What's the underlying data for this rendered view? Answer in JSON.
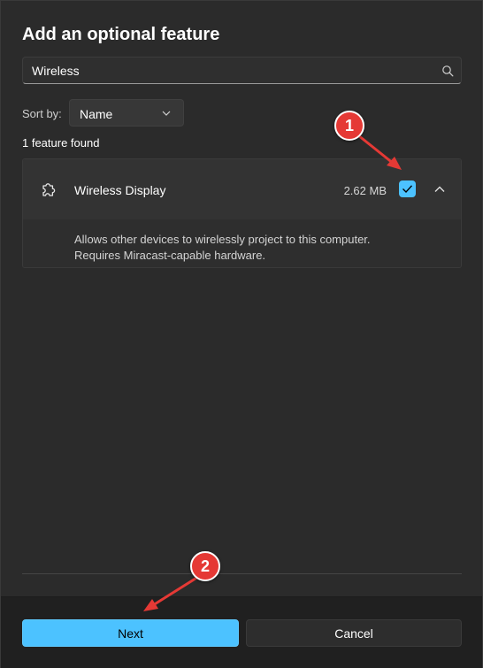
{
  "dialog": {
    "title": "Add an optional feature"
  },
  "search": {
    "value": "Wireless",
    "icon": "search-icon"
  },
  "sort": {
    "label": "Sort by:",
    "selected": "Name"
  },
  "results": {
    "count_text": "1 feature found"
  },
  "features": [
    {
      "name": "Wireless Display",
      "size": "2.62 MB",
      "checked": true,
      "expanded": true,
      "description_line1": "Allows other devices to wirelessly project to this computer.",
      "description_line2": "Requires Miracast-capable hardware."
    }
  ],
  "footer": {
    "next_label": "Next",
    "cancel_label": "Cancel"
  },
  "annotations": {
    "step1": "1",
    "step2": "2"
  },
  "colors": {
    "accent": "#4cc2ff",
    "annotation": "#e53935"
  }
}
